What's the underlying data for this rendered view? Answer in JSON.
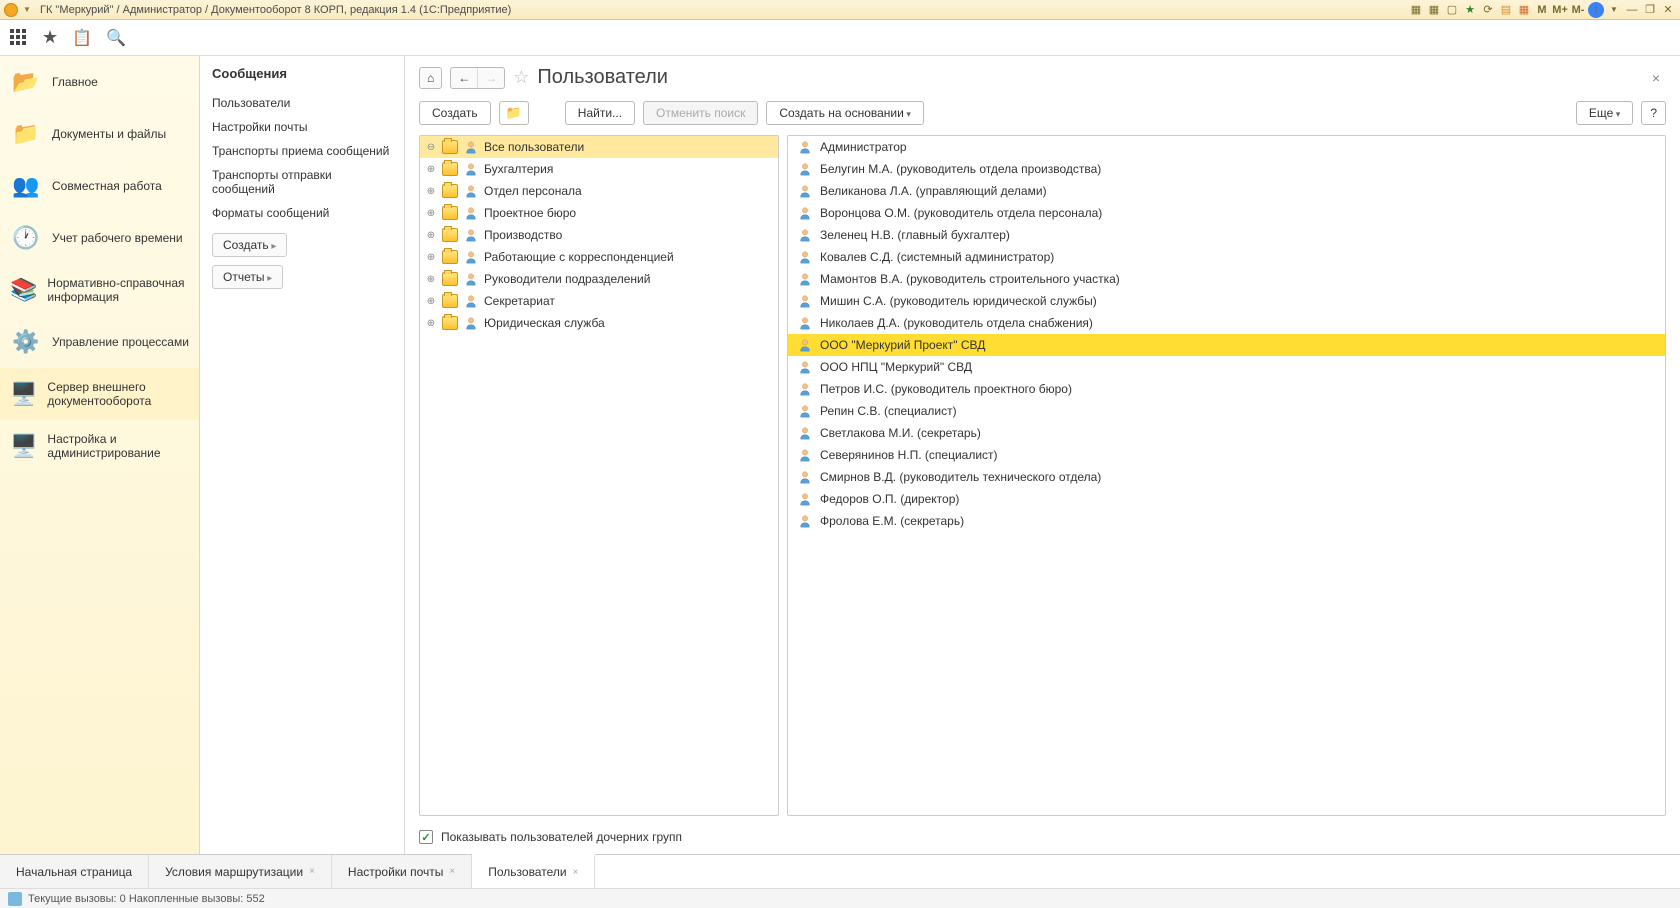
{
  "titlebar": {
    "title": "ГК \"Меркурий\" / Администратор / Документооборот 8 КОРП, редакция 1.4  (1С:Предприятие)",
    "m1": "M",
    "m2": "M+",
    "m3": "M-"
  },
  "sidebar": {
    "items": [
      {
        "label": "Главное",
        "icon": "📂"
      },
      {
        "label": "Документы и файлы",
        "icon": "📁"
      },
      {
        "label": "Совместная работа",
        "icon": "👥"
      },
      {
        "label": "Учет рабочего времени",
        "icon": "🕐"
      },
      {
        "label": "Нормативно-справочная информация",
        "icon": "📚"
      },
      {
        "label": "Управление процессами",
        "icon": "⚙️"
      },
      {
        "label": "Сервер внешнего документооборота",
        "icon": "🖥️"
      },
      {
        "label": "Настройка и администрирование",
        "icon": "🖥️"
      }
    ]
  },
  "subnav": {
    "heading": "Сообщения",
    "links": [
      "Пользователи",
      "Настройки почты",
      "Транспорты приема сообщений",
      "Транспорты отправки сообщений",
      "Форматы сообщений"
    ],
    "btn_create": "Создать",
    "btn_reports": "Отчеты"
  },
  "page": {
    "title": "Пользователи",
    "btn_create": "Создать",
    "btn_find": "Найти...",
    "btn_cancel_search": "Отменить поиск",
    "btn_create_based": "Создать на основании",
    "btn_more": "Еще",
    "btn_help": "?"
  },
  "groups": [
    {
      "label": "Все пользователи",
      "selected": true
    },
    {
      "label": "Бухгалтерия"
    },
    {
      "label": "Отдел персонала"
    },
    {
      "label": "Проектное бюро"
    },
    {
      "label": "Производство"
    },
    {
      "label": "Работающие с корреспонденцией"
    },
    {
      "label": "Руководители подразделений"
    },
    {
      "label": "Секретариат"
    },
    {
      "label": "Юридическая служба"
    }
  ],
  "users": [
    {
      "label": "Администратор"
    },
    {
      "label": "Белугин М.А. (руководитель отдела производства)"
    },
    {
      "label": "Великанова Л.А. (управляющий делами)"
    },
    {
      "label": "Воронцова О.М. (руководитель отдела персонала)"
    },
    {
      "label": "Зеленец Н.В. (главный бухгалтер)"
    },
    {
      "label": "Ковалев С.Д. (системный администратор)"
    },
    {
      "label": "Мамонтов В.А. (руководитель строительного участка)"
    },
    {
      "label": "Мишин С.А. (руководитель юридической службы)"
    },
    {
      "label": "Николаев Д.А. (руководитель отдела снабжения)"
    },
    {
      "label": "ООО \"Меркурий Проект\" СВД",
      "selected": true
    },
    {
      "label": "ООО НПЦ \"Меркурий\" СВД"
    },
    {
      "label": "Петров И.С. (руководитель проектного бюро)"
    },
    {
      "label": "Репин С.В. (специалист)"
    },
    {
      "label": "Светлакова М.И. (секретарь)"
    },
    {
      "label": "Северянинов Н.П. (специалист)"
    },
    {
      "label": "Смирнов В.Д. (руководитель технического отдела)"
    },
    {
      "label": "Федоров О.П. (директор)"
    },
    {
      "label": "Фролова Е.М. (секретарь)"
    }
  ],
  "checkbox": {
    "label": "Показывать пользователей дочерних групп",
    "checked": true
  },
  "tabs": [
    {
      "label": "Начальная страница"
    },
    {
      "label": "Условия маршрутизации",
      "closable": true
    },
    {
      "label": "Настройки почты",
      "closable": true
    },
    {
      "label": "Пользователи",
      "closable": true,
      "active": true
    }
  ],
  "statusbar": {
    "text": "Текущие вызовы: 0  Накопленные вызовы: 552"
  }
}
